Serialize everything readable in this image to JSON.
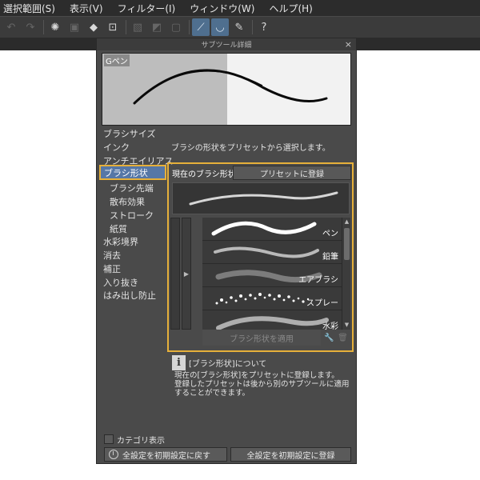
{
  "menu": {
    "items": [
      "選択範囲(S)",
      "表示(V)",
      "フィルター(I)",
      "ウィンドウ(W)",
      "ヘルプ(H)"
    ]
  },
  "toolbar": {
    "icons": [
      "undo-icon",
      "redo-icon",
      "loading-icon",
      "copy-icon",
      "fill-icon",
      "transform-icon",
      "snap-icon",
      "snap-special-icon",
      "snap-grid-icon",
      "stabilize-icon",
      "curve-icon",
      "pen-pressure-icon",
      "help-icon"
    ]
  },
  "panel": {
    "title": "サブツール詳細",
    "close": "×",
    "preview_name": "Gペン"
  },
  "categories": {
    "items": [
      {
        "label": "ブラシサイズ"
      },
      {
        "label": "インク"
      },
      {
        "label": "アンチエイリアス"
      },
      {
        "label": "ブラシ形状"
      },
      {
        "label": "ブラシ先端"
      },
      {
        "label": "散布効果"
      },
      {
        "label": "ストローク"
      },
      {
        "label": "紙質"
      },
      {
        "label": "水彩境界"
      },
      {
        "label": "消去"
      },
      {
        "label": "補正"
      },
      {
        "label": "入り抜き"
      },
      {
        "label": "はみ出し防止"
      }
    ],
    "selected": "ブラシ形状"
  },
  "shape": {
    "description": "ブラシの形状をプリセットから選択します。",
    "tab_current": "現在のブラシ形状",
    "tab_register": "プリセットに登録",
    "presets": [
      {
        "label": "ペン"
      },
      {
        "label": "鉛筆"
      },
      {
        "label": "エアブラシ"
      },
      {
        "label": "スプレー"
      },
      {
        "label": "水彩"
      }
    ],
    "apply_label": "ブラシ形状を適用"
  },
  "info": {
    "icon": "i",
    "title": "[ブラシ形状]について",
    "body": "現在の[ブラシ形状]をプリセットに登録します。\n登録したプリセットは後から別のサブツールに適用することができます。"
  },
  "footer": {
    "category_toggle": "カテゴリ表示",
    "reset_label": "全設定を初期設定に戻す",
    "register_label": "全設定を初期設定に登録"
  }
}
